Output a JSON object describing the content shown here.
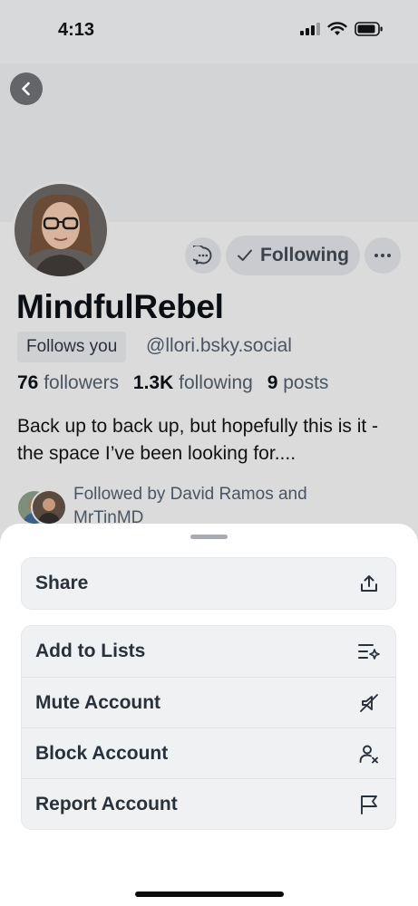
{
  "status_bar": {
    "time": "4:13"
  },
  "profile": {
    "display_name": "MindfulRebel",
    "follows_you": "Follows you",
    "handle": "@llori.bsky.social",
    "stats": {
      "followers_count": "76",
      "followers_label": "followers",
      "following_count": "1.3K",
      "following_label": "following",
      "posts_count": "9",
      "posts_label": "posts"
    },
    "bio": "Back up to back up, but hopefully this is it - the space I’ve been looking for....",
    "followed_by": "Followed by David Ramos and MrTinMD"
  },
  "actions": {
    "following_label": "Following"
  },
  "sheet": {
    "share": {
      "label": "Share",
      "icon": "share-icon"
    },
    "items": [
      {
        "label": "Add to Lists",
        "icon": "list-add-icon"
      },
      {
        "label": "Mute Account",
        "icon": "mute-icon"
      },
      {
        "label": "Block Account",
        "icon": "block-user-icon"
      },
      {
        "label": "Report Account",
        "icon": "flag-icon"
      }
    ]
  },
  "colors": {
    "sheet_bg": "#ffffff",
    "card_bg": "#f0f1f3",
    "text_primary": "#0b0f14",
    "text_secondary": "#4a5563"
  }
}
